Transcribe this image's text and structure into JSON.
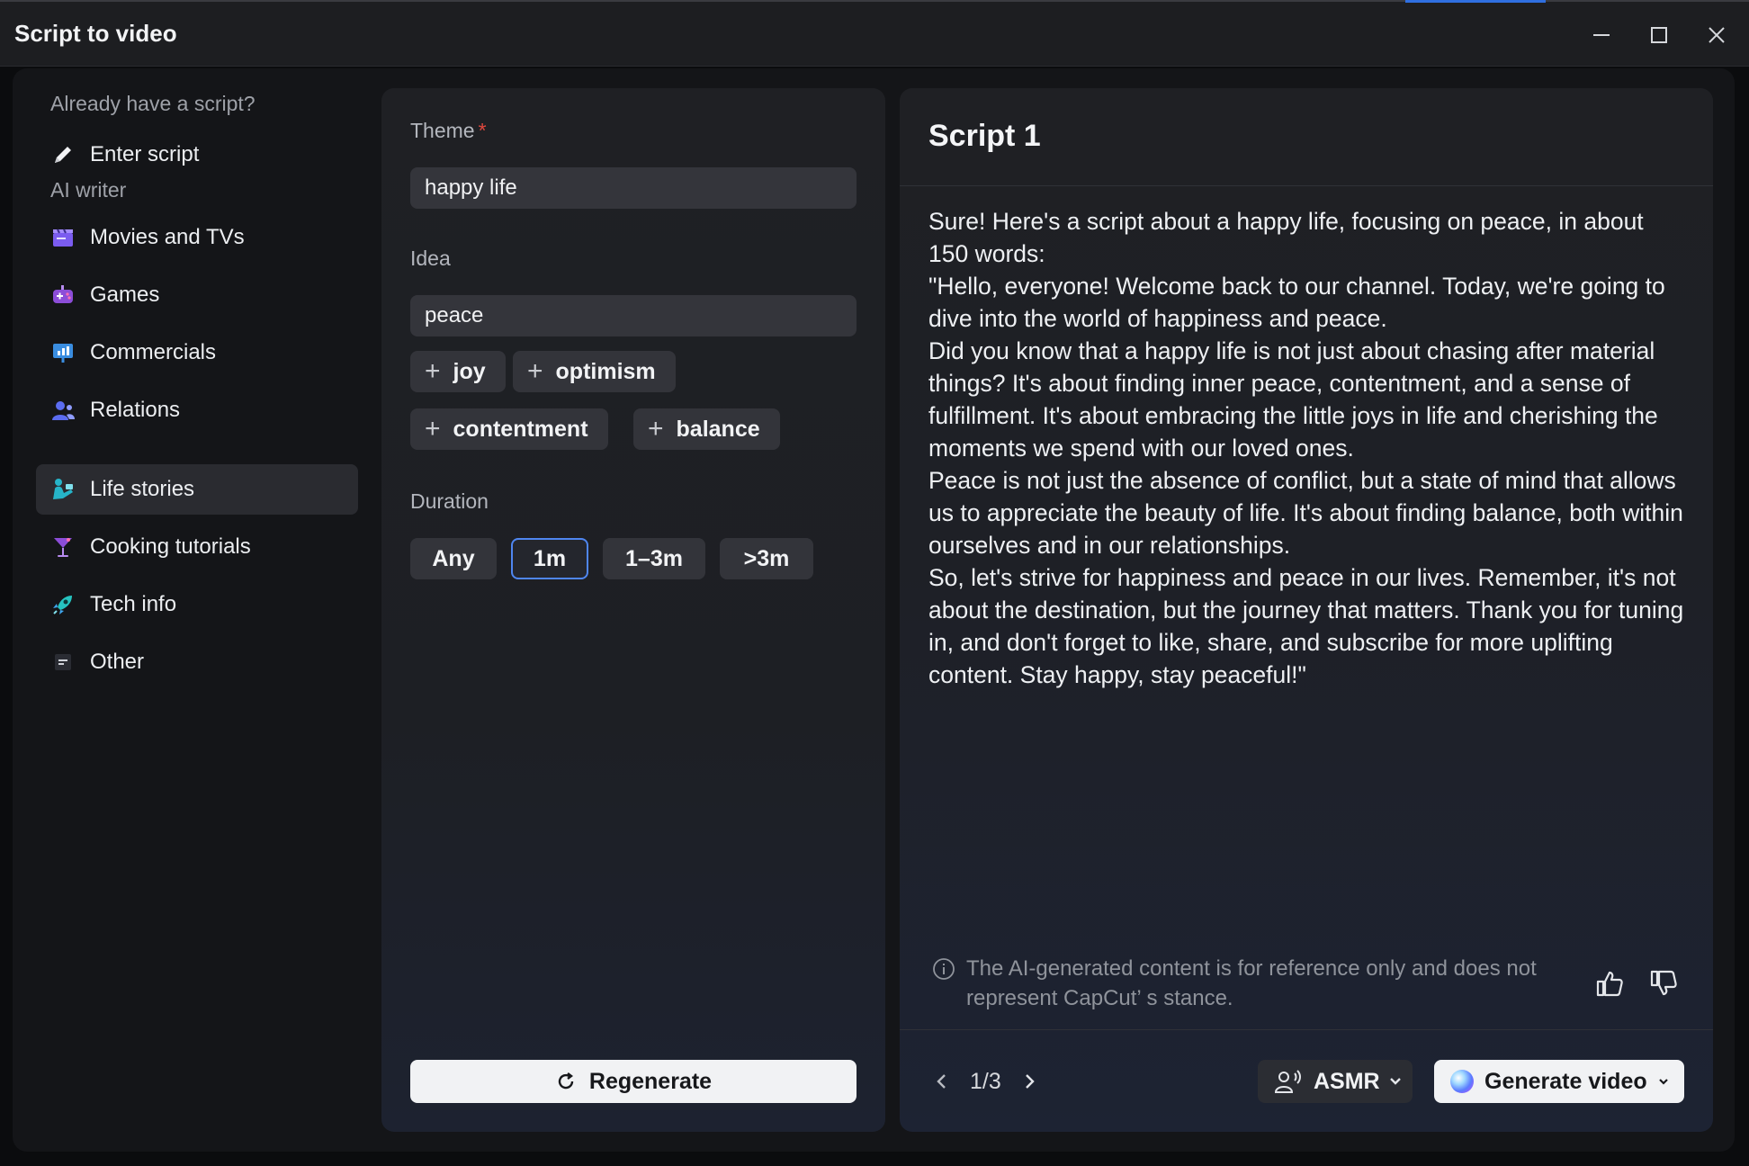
{
  "window": {
    "title": "Script to video"
  },
  "sidebar": {
    "section_existing": "Already have a script?",
    "enter_script": "Enter script",
    "section_ai": "AI writer",
    "items": [
      {
        "label": "Movies and TVs",
        "icon": "clapperboard-icon",
        "color": "#7b5cf0"
      },
      {
        "label": "Games",
        "icon": "gamepad-icon",
        "color": "#8c4dd8"
      },
      {
        "label": "Commercials",
        "icon": "presentation-icon",
        "color": "#3a8de0"
      },
      {
        "label": "Relations",
        "icon": "people-icon",
        "color": "#5b6cf0"
      },
      {
        "label": "Life stories",
        "icon": "person-reading-icon",
        "color": "#26b4c8"
      },
      {
        "label": "Cooking tutorials",
        "icon": "cocktail-glass-icon",
        "color": "#8c4dd8"
      },
      {
        "label": "Tech info",
        "icon": "rocket-icon",
        "color": "#26c4c0"
      },
      {
        "label": "Other",
        "icon": "note-lines-icon",
        "color": "#b8bcc4"
      }
    ],
    "active_item": "Life stories"
  },
  "form": {
    "theme_label": "Theme",
    "theme_required": "*",
    "theme_value": "happy life",
    "idea_label": "Idea",
    "idea_value": "peace",
    "suggestions": [
      "joy",
      "optimism",
      "contentment",
      "balance"
    ],
    "duration_label": "Duration",
    "durations": [
      "Any",
      "1m",
      "1–3m",
      ">3m"
    ],
    "selected_duration": "1m",
    "regenerate_label": "Regenerate"
  },
  "script": {
    "title": "Script 1",
    "paragraphs": [
      "Sure! Here's a script about a happy life, focusing on peace, in about 150 words:",
      "\"Hello, everyone! Welcome back to our channel. Today, we're going to dive into the world of happiness and peace.",
      "Did you know that a happy life is not just about chasing after material things? It's about finding inner peace, contentment, and a sense of fulfillment. It's about embracing the little joys in life and cherishing the moments we spend with our loved ones.",
      "Peace is not just the absence of conflict, but a state of mind that allows us to appreciate the beauty of life. It's about finding balance, both within ourselves and in our relationships.",
      "So, let's strive for happiness and peace in our lives. Remember, it's not about the destination, but the journey that matters. Thank you for tuning in, and don't forget to like, share, and subscribe for more uplifting content. Stay happy, stay peaceful!\""
    ],
    "disclaimer": "The AI-generated content is for reference only and does not represent CapCut’ s stance.",
    "pager": "1/3",
    "voice_label": "ASMR",
    "generate_label": "Generate video"
  },
  "colors": {
    "accent": "#4f86f0",
    "required": "#e0483e"
  }
}
